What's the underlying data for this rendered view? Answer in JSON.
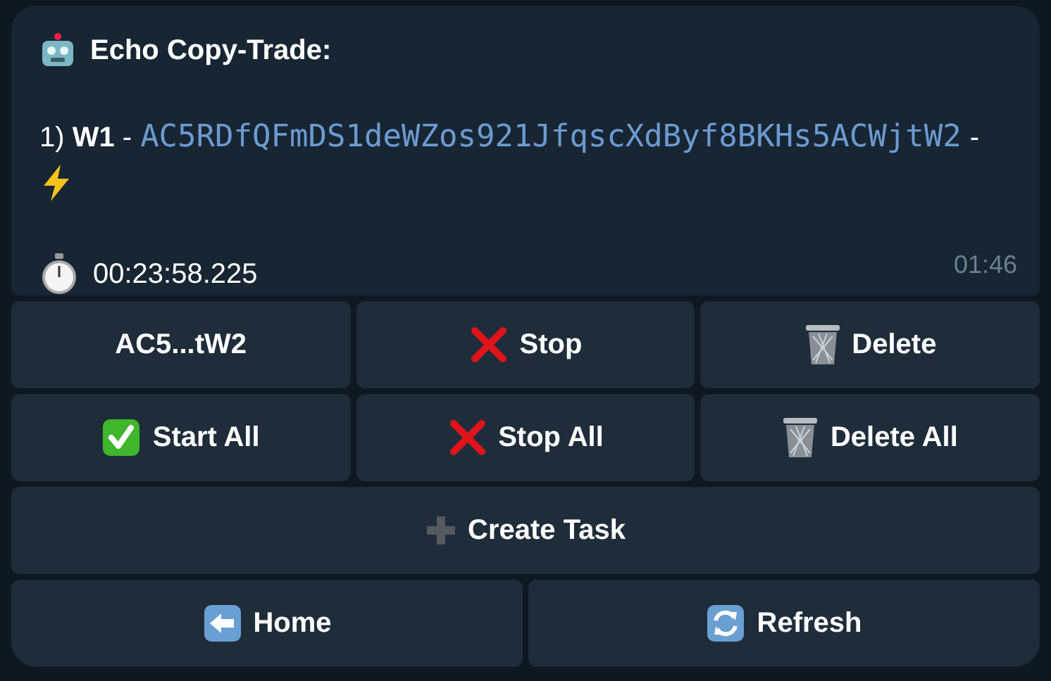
{
  "message": {
    "title": "Echo Copy-Trade:",
    "entry": {
      "prefix": "1) **W1** -",
      "address": "AC5RDfQFmDS1deWZos921JfqscXdByf8BKHs5ACWjtW2",
      "suffix": "-"
    },
    "elapsed": "00:23:58.225",
    "time": "01:46"
  },
  "keyboard": [
    [
      {
        "label": "AC5...tW2",
        "kind": "plain"
      },
      {
        "label": "Stop",
        "kind": "cross"
      },
      {
        "label": "Delete",
        "kind": "trash"
      }
    ],
    [
      {
        "label": "Start All",
        "kind": "check"
      },
      {
        "label": "Stop All",
        "kind": "cross"
      },
      {
        "label": "Delete All",
        "kind": "trash"
      }
    ],
    [
      {
        "label": "Create Task",
        "kind": "plus"
      }
    ],
    [
      {
        "label": "Home",
        "kind": "back"
      },
      {
        "label": "Refresh",
        "kind": "refresh"
      }
    ]
  ]
}
